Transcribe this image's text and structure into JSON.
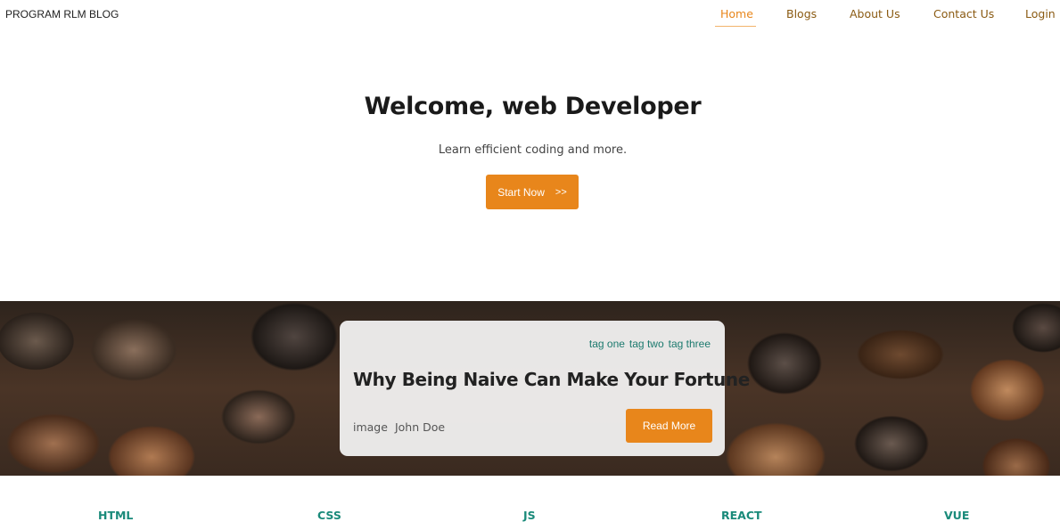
{
  "brand": "PROGRAM RLM BLOG",
  "nav": {
    "items": [
      {
        "label": "Home",
        "active": true
      },
      {
        "label": "Blogs"
      },
      {
        "label": "About Us"
      },
      {
        "label": "Contact Us"
      },
      {
        "label": "Login"
      }
    ]
  },
  "hero": {
    "title": "Welcome, web Developer",
    "subtitle": "Learn efficient coding and more.",
    "cta_label": "Start Now",
    "cta_arrows": ">>"
  },
  "featured": {
    "tags": [
      "tag one",
      "tag two",
      "tag three"
    ],
    "title": "Why Being Naive Can Make Your Fortune",
    "image_label": "image",
    "author": "John Doe",
    "read_more_label": "Read More"
  },
  "topics": [
    "HTML",
    "CSS",
    "JS",
    "REACT",
    "VUE"
  ],
  "colors": {
    "accent": "#e8861b",
    "nav_text": "#8a5a12",
    "teal": "#1a8a7a"
  }
}
